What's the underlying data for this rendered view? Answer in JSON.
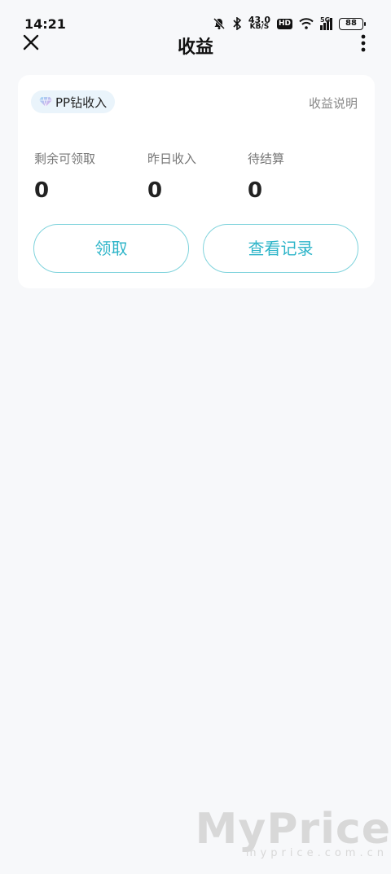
{
  "status_bar": {
    "time": "14:21",
    "net_speed_value": "43.0",
    "net_speed_unit": "KB/S",
    "hd_label": "HD",
    "network_label": "5G",
    "battery": "88"
  },
  "nav": {
    "title": "收益"
  },
  "card": {
    "chip_label": "PP钻收入",
    "explain_link": "收益说明",
    "stats": [
      {
        "label": "剩余可领取",
        "value": "0"
      },
      {
        "label": "昨日收入",
        "value": "0"
      },
      {
        "label": "待结算",
        "value": "0"
      }
    ],
    "claim_button": "领取",
    "records_button": "查看记录"
  },
  "watermark": {
    "brand": "MyPrice",
    "url": "myprice.com.cn"
  },
  "colors": {
    "accent": "#2fb5c9",
    "button_border": "#7fd3dc",
    "background": "#f7f8fa"
  }
}
